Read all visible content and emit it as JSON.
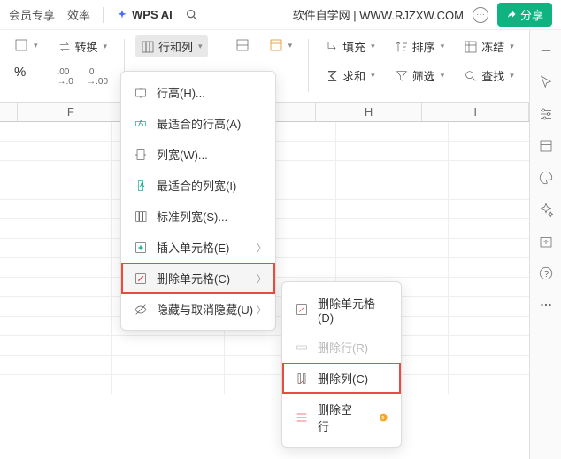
{
  "topbar": {
    "member": "会员专享",
    "eff": "效率",
    "ai": "WPS AI",
    "site": "软件自学网 | WWW.RJZXW.COM",
    "share": "分享"
  },
  "ribbon": {
    "convert": "转换",
    "rowcol": "行和列",
    "fill": "填充",
    "sort": "排序",
    "freeze": "冻结",
    "sum": "求和",
    "filter": "筛选",
    "find": "查找",
    "pct": "%",
    "dec": ".0",
    "d1": ".00",
    "d2": ".00"
  },
  "cols": {
    "f": "F",
    "h": "H",
    "i": "I"
  },
  "menu1": {
    "h": "行高(H)...",
    "fitH": "最适合的行高(A)",
    "w": "列宽(W)...",
    "fitW": "最适合的列宽(I)",
    "stdW": "标准列宽(S)...",
    "ins": "插入单元格(E)",
    "del": "删除单元格(C)",
    "hide": "隐藏与取消隐藏(U)"
  },
  "menu2": {
    "delCell": "删除单元格(D)",
    "delRow": "删除行(R)",
    "delCol": "删除列(C)",
    "delBlank": "删除空行"
  }
}
